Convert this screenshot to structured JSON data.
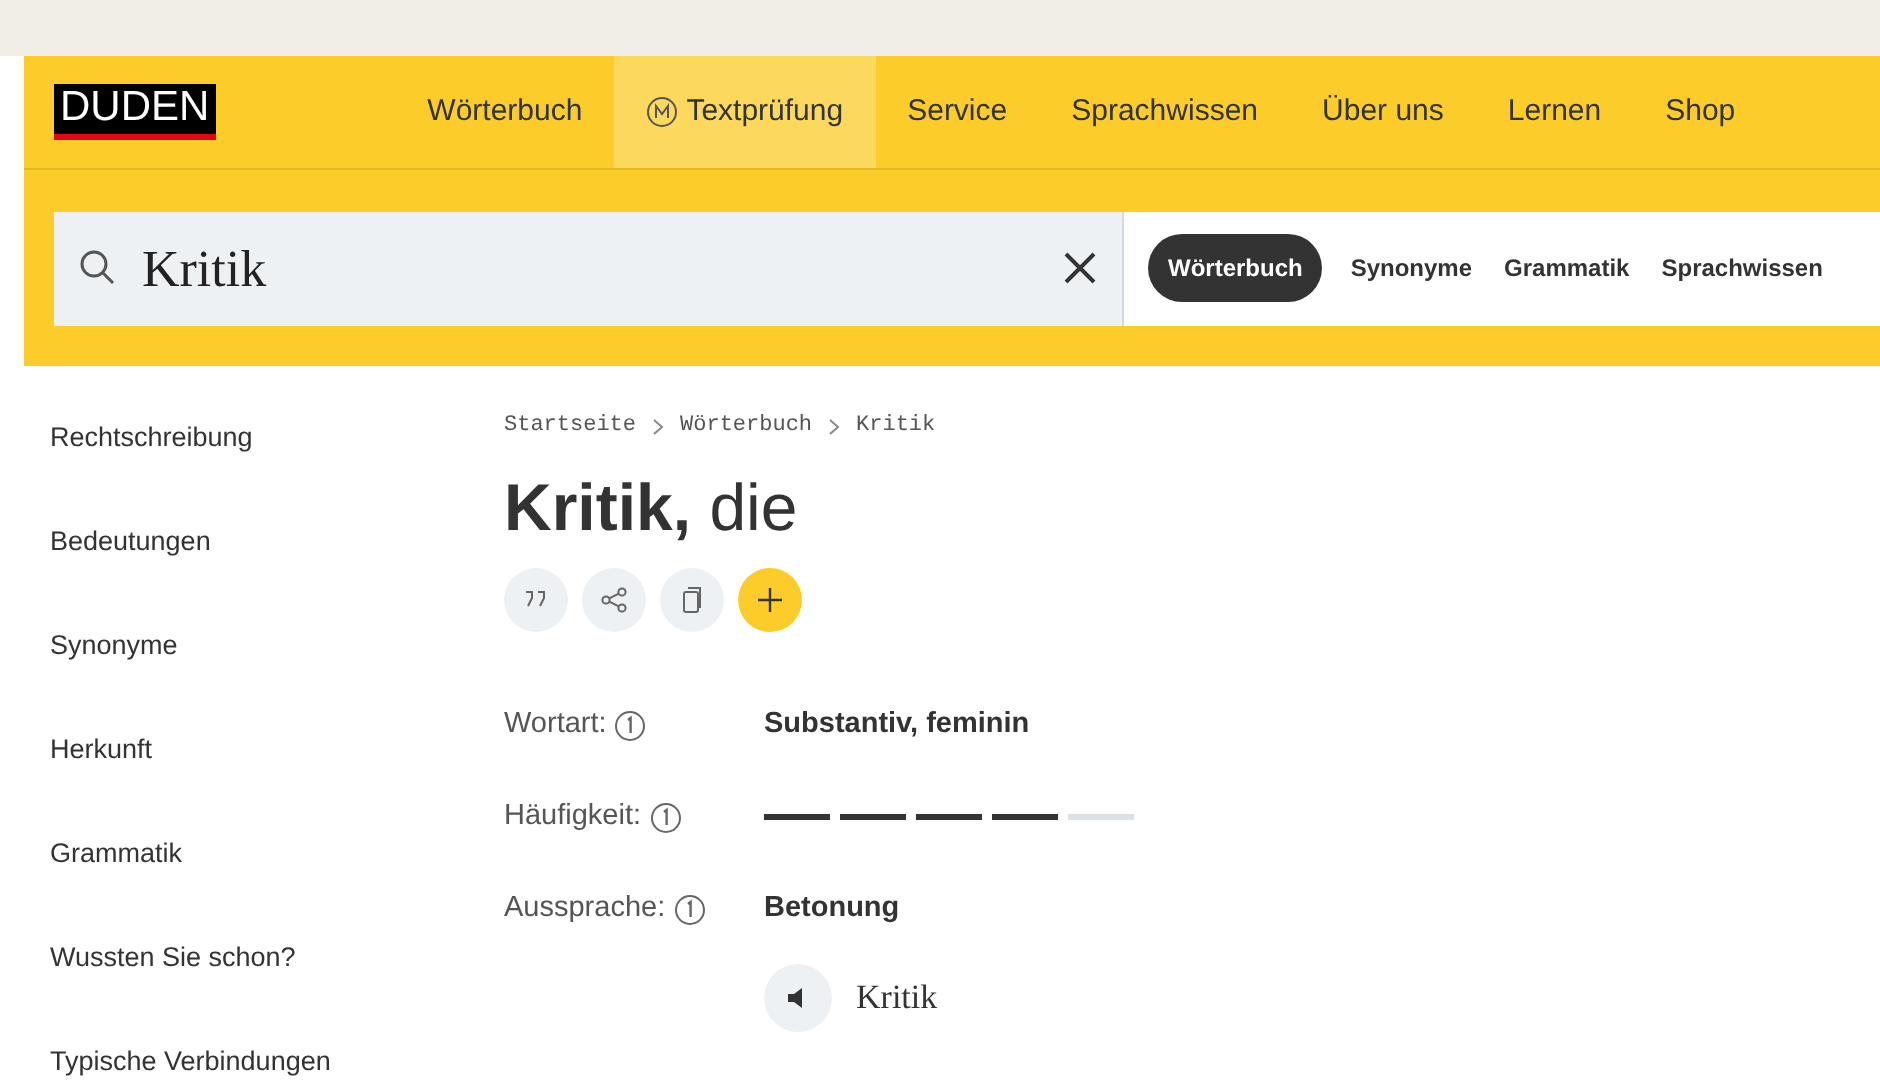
{
  "header": {
    "logo": "DUDEN",
    "nav": [
      {
        "label": "Wörterbuch",
        "selected": false,
        "kind": "plain"
      },
      {
        "label": "Textprüfung",
        "selected": true,
        "kind": "badge"
      },
      {
        "label": "Service",
        "selected": false,
        "kind": "plain"
      },
      {
        "label": "Sprachwissen",
        "selected": false,
        "kind": "plain"
      },
      {
        "label": "Über uns",
        "selected": false,
        "kind": "plain"
      },
      {
        "label": "Lernen",
        "selected": false,
        "kind": "plain"
      },
      {
        "label": "Shop",
        "selected": false,
        "kind": "plain"
      }
    ]
  },
  "search": {
    "value": "Kritik",
    "scopes": [
      {
        "label": "Wörterbuch",
        "selected": true
      },
      {
        "label": "Synonyme",
        "selected": false
      },
      {
        "label": "Grammatik",
        "selected": false
      },
      {
        "label": "Sprachwissen",
        "selected": false
      }
    ]
  },
  "sidebar": {
    "items": [
      "Rechtschreibung",
      "Bedeutungen",
      "Synonyme",
      "Herkunft",
      "Grammatik",
      "Wussten Sie schon?",
      "Typische Verbindungen"
    ]
  },
  "breadcrumb": [
    "Startseite",
    "Wörterbuch",
    "Kritik"
  ],
  "entry": {
    "lemma": "Kritik,",
    "article": "die"
  },
  "details": [
    {
      "kind": "text",
      "label": "Wortart:",
      "value": "Substantiv, feminin"
    },
    {
      "kind": "meter",
      "label": "Häufigkeit:",
      "level": 0.8
    },
    {
      "kind": "text",
      "label": "Aussprache:",
      "value": "Betonung"
    }
  ],
  "pronunciation": {
    "word": "Kritik"
  }
}
